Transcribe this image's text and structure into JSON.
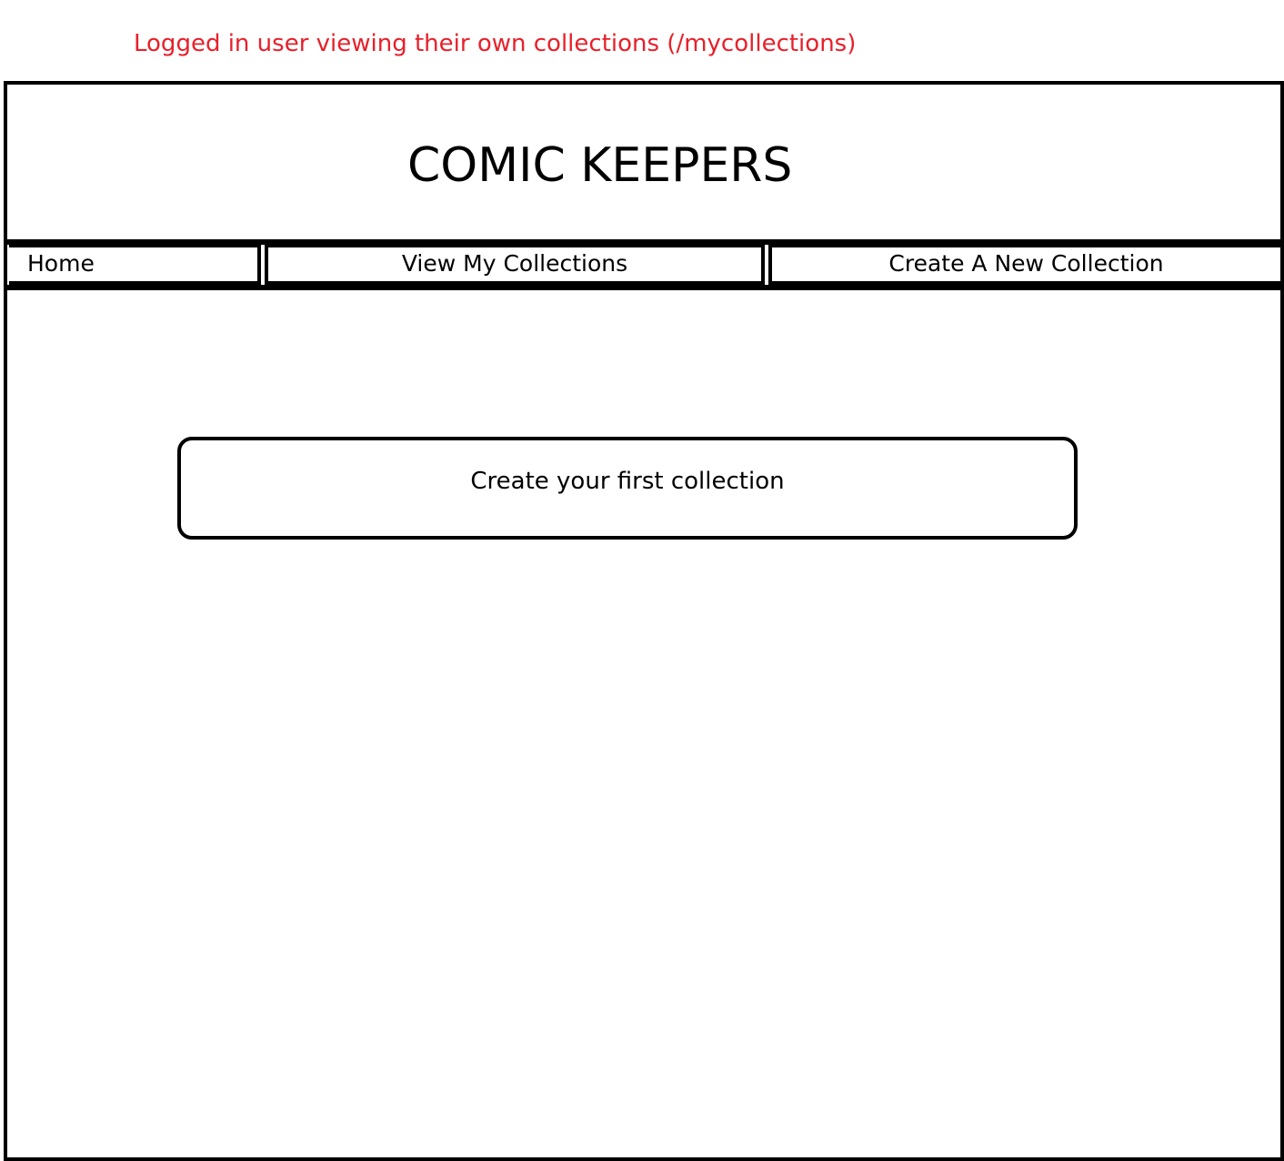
{
  "annotation": {
    "text": "Logged in user viewing their own collections (/mycollections)",
    "color": "#e8202a"
  },
  "header": {
    "site_title": "COMIC KEEPERS"
  },
  "nav": {
    "items": [
      {
        "label": "Home"
      },
      {
        "label": "View My Collections"
      },
      {
        "label": "Create A New Collection"
      }
    ]
  },
  "main": {
    "empty_state_button": "Create your first collection"
  }
}
